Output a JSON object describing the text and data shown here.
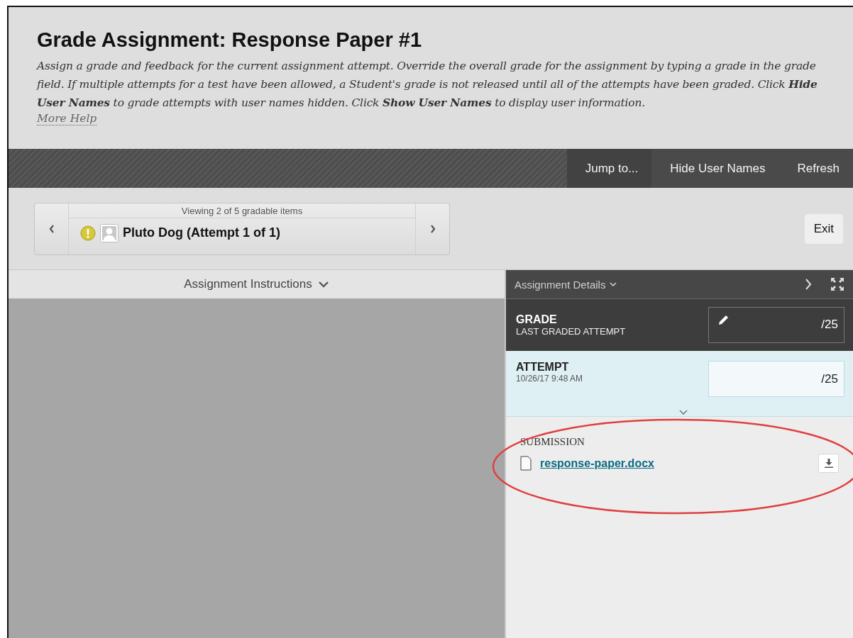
{
  "header": {
    "title": "Grade Assignment: Response Paper #1",
    "description": "Assign a grade and feedback for the current assignment attempt. Override the overall grade for the assignment by typing a grade in the grade field. If multiple attempts for a test have been allowed, a Student's grade is not released until all of the attempts have been graded. Click **Hide User Names** to grade attempts with user names hidden. Click **Show User Names** to display user information.",
    "help_link": "More Help"
  },
  "toolbar": {
    "buttons": [
      {
        "label": "Jump to...",
        "kind": "menu"
      },
      {
        "label": "Hide User Names",
        "kind": "plain"
      },
      {
        "label": "Refresh",
        "kind": "plain"
      }
    ]
  },
  "navigator": {
    "counter": "Viewing 2 of 5 gradable items",
    "student": "Pluto Dog (Attempt 1 of 1)",
    "needs_grading": true
  },
  "exit_button": "Exit",
  "instructions_tab": {
    "label": "Assignment Instructions",
    "expanded": false
  },
  "details_panel": {
    "title": "Assignment Details",
    "grade": {
      "label": "GRADE",
      "sublabel": "LAST GRADED ATTEMPT",
      "out_of": "/25"
    },
    "attempt": {
      "label": "ATTEMPT",
      "date": "10/26/17 9:48 AM",
      "out_of": "/25"
    },
    "submission": {
      "label": "SUBMISSION",
      "file": "response-paper.docx"
    },
    "highlighted": true
  }
}
